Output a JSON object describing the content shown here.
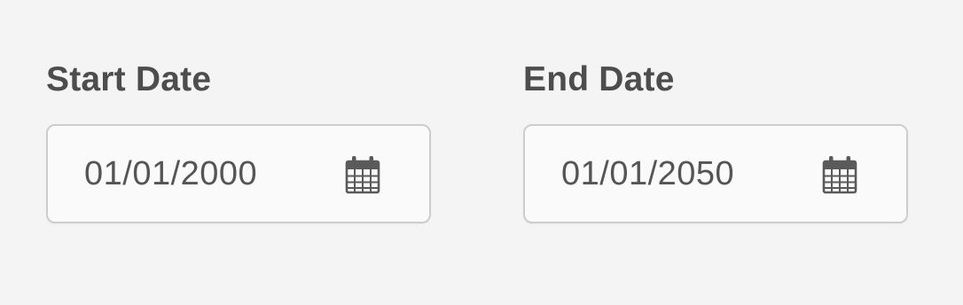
{
  "start_date": {
    "label": "Start Date",
    "value": "01/01/2000",
    "icon": "calendar-icon"
  },
  "end_date": {
    "label": "End Date",
    "value": "01/01/2050",
    "icon": "calendar-icon"
  },
  "colors": {
    "background": "#f4f4f4",
    "label_text": "#4d4d4d",
    "value_text": "#555555",
    "input_border": "#cdcdcd",
    "input_background": "#fafafa",
    "icon": "#5a5a5a"
  }
}
